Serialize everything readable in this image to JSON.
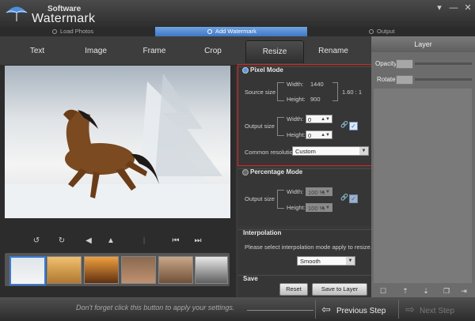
{
  "app": {
    "subtitle": "Software",
    "name": "Watermark"
  },
  "window_controls": {
    "menu": "▾",
    "minimize": "—",
    "close": "✕"
  },
  "steps": [
    {
      "label": "Load Photos"
    },
    {
      "label": "Add Watermark"
    },
    {
      "label": "Output"
    }
  ],
  "tabs": [
    "Text",
    "Image",
    "Frame",
    "Crop",
    "Resize",
    "Rename"
  ],
  "active_tab": "Resize",
  "pixel_mode": {
    "title": "Pixel Mode",
    "source_label": "Source size",
    "width_label": "Width:",
    "width_value": "1440",
    "height_label": "Height:",
    "height_value": "900",
    "ratio": "1.60 : 1",
    "output_label": "Output size",
    "out_width_label": "Width:",
    "out_width_value": "0",
    "out_height_label": "Height:",
    "out_height_value": "0",
    "common_label": "Common resolution:",
    "common_value": "Custom"
  },
  "percentage_mode": {
    "title": "Percentage Mode",
    "output_label": "Output size",
    "width_label": "Width:",
    "width_value": "100",
    "height_label": "Height:",
    "height_value": "100",
    "unit": "%"
  },
  "interpolation": {
    "title": "Interpolation",
    "description": "Please select interpolation mode apply to resize.",
    "value": "Smooth"
  },
  "save": {
    "title": "Save",
    "reset_label": "Reset",
    "save_to_layer_label": "Save to Layer"
  },
  "layer": {
    "title": "Layer",
    "opacity_label": "Opacity",
    "rotate_label": "Rotate"
  },
  "footer": {
    "hint": "Don't forget click this button to apply your settings.",
    "previous_label": "Previous Step",
    "next_label": "Next Step"
  },
  "colors": {
    "accent": "#4a84d4",
    "highlight_box": "#e0241c"
  }
}
